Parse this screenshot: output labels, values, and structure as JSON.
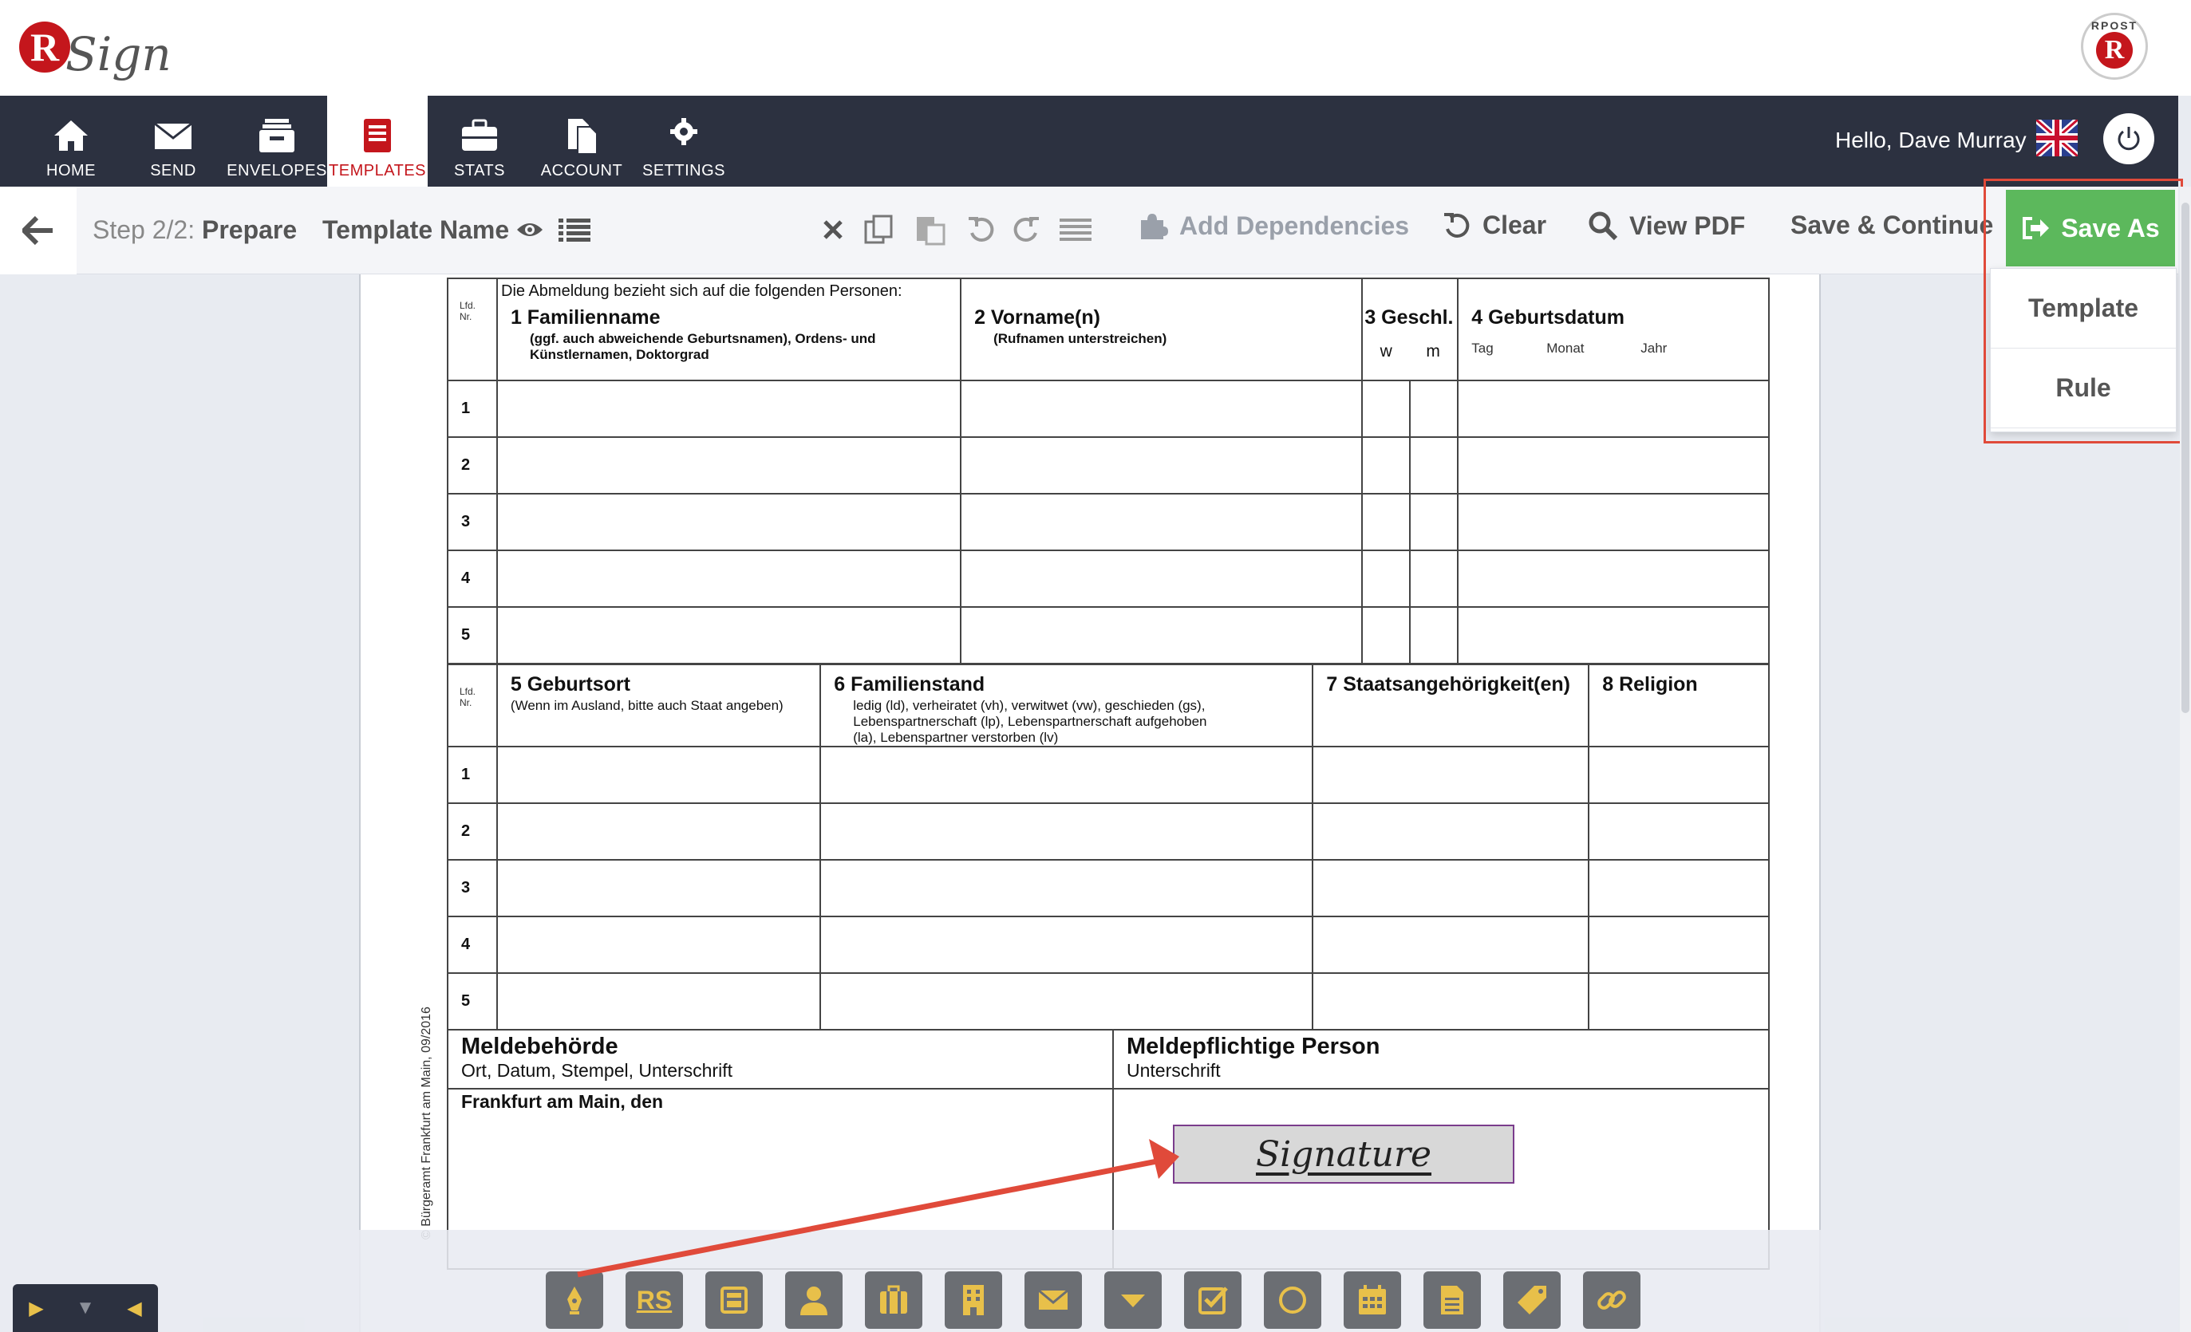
{
  "brand": {
    "logo_letter": "R",
    "logo_text": "Sign",
    "rpost_top": "RPOST",
    "rpost_letter": "R"
  },
  "nav": {
    "items": [
      {
        "label": "HOME",
        "icon": "home-icon"
      },
      {
        "label": "SEND",
        "icon": "envelope-icon"
      },
      {
        "label": "ENVELOPES",
        "icon": "inbox-icon"
      },
      {
        "label": "TEMPLATES",
        "icon": "templates-icon",
        "active": true
      },
      {
        "label": "STATS",
        "icon": "briefcase-icon"
      },
      {
        "label": "ACCOUNT",
        "icon": "account-icon"
      },
      {
        "label": "SETTINGS",
        "icon": "gear-icon"
      }
    ],
    "greeting": "Hello,",
    "user": "Dave Murray"
  },
  "toolbar": {
    "step_prefix": "Step 2/2:",
    "step_name": "Prepare",
    "template_name": "Template Name",
    "add_dependencies": "Add Dependencies",
    "clear": "Clear",
    "view_pdf": "View PDF",
    "save_continue": "Save & Continue",
    "save_as": "Save As",
    "save_as_menu": [
      "Template",
      "Rule"
    ]
  },
  "form": {
    "intro": "Die Abmeldung bezieht sich auf die folgenden Personen:",
    "lfd": "Lfd.",
    "nr": "Nr.",
    "table1": {
      "col1_title": "1  Familienname",
      "col1_sub": "(ggf. auch abweichende Geburtsnamen), Ordens- und Künstlernamen, Doktorgrad",
      "col2_title": "2  Vorname(n)",
      "col2_sub": "(Rufnamen unterstreichen)",
      "col3_title": "3 Geschl.",
      "col3_w": "w",
      "col3_m": "m",
      "col4_title": "4  Geburtsdatum",
      "col4_tag": "Tag",
      "col4_monat": "Monat",
      "col4_jahr": "Jahr",
      "rows": [
        "1",
        "2",
        "3",
        "4",
        "5"
      ]
    },
    "table2": {
      "col1_title": "5  Geburtsort",
      "col1_sub": "(Wenn im Ausland, bitte auch Staat angeben)",
      "col2_title": "6  Familienstand",
      "col2_sub": "ledig (ld), verheiratet (vh), verwitwet (vw), geschieden (gs), Lebenspartnerschaft (lp), Lebenspartnerschaft aufgehoben (la), Lebenspartner verstorben (lv)",
      "col3_title": "7  Staatsangehörigkeit(en)",
      "col4_title": "8  Religion",
      "rows": [
        "1",
        "2",
        "3",
        "4",
        "5"
      ]
    },
    "meldebehoerde": "Meldebehörde",
    "meldebehoerde_sub": "Ort, Datum, Stempel, Unterschrift",
    "ort": "Frankfurt am Main, den",
    "meldepflichtige": "Meldepflichtige Person",
    "meldepflichtige_sub": "Unterschrift",
    "vertical_note": "© Bürgeramt Frankfurt am Main, 09/2016",
    "signature_label": "Signature"
  },
  "palette": {
    "items": [
      "signature-pen-icon",
      "initials-rs-icon",
      "stamp-icon",
      "user-icon",
      "title-icon",
      "company-icon",
      "email-icon",
      "dropdown-icon",
      "checkbox-icon",
      "radio-icon",
      "date-icon",
      "text-icon",
      "label-icon",
      "hyperlink-icon"
    ],
    "rs_label": "RS"
  },
  "colors": {
    "nav_bg": "#2c3140",
    "accent_red": "#c4161c",
    "save_green": "#5cb85c",
    "annotation_red": "#e04a3a",
    "palette_icon": "#e8c04a"
  }
}
